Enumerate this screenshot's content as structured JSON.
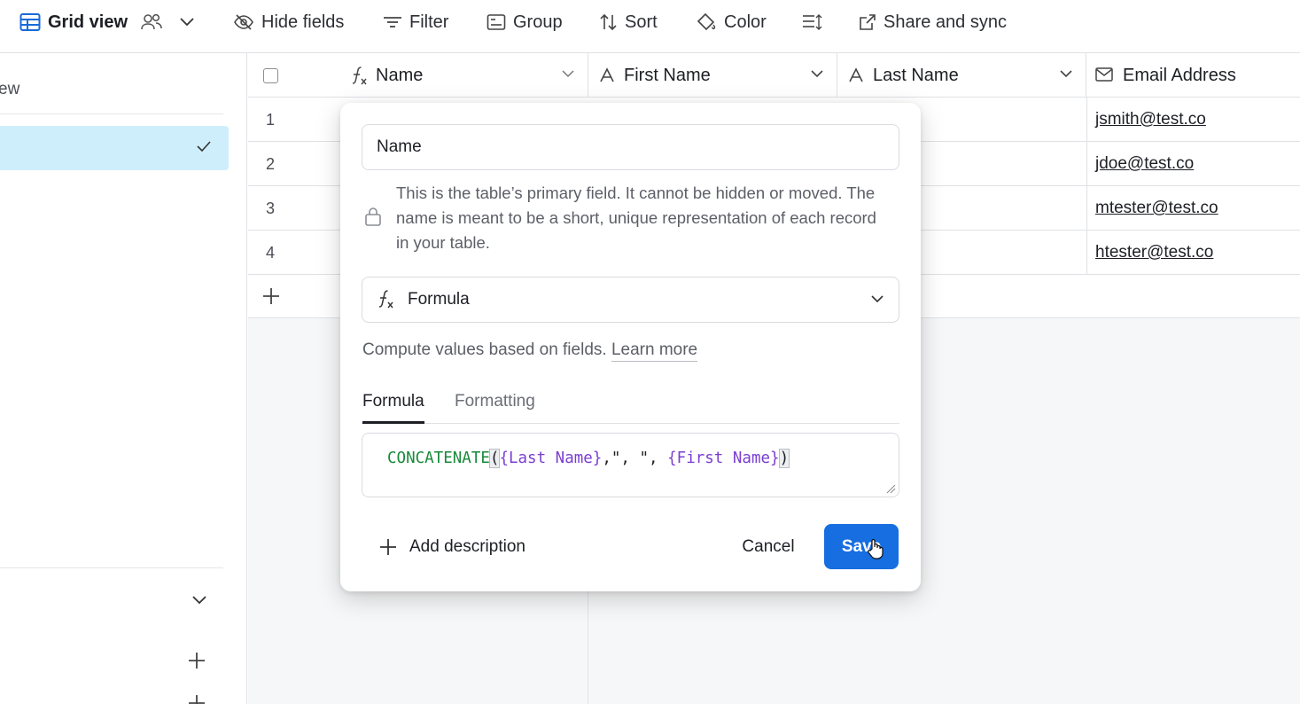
{
  "toolbar": {
    "view_name": "Grid view",
    "hide_fields": "Hide fields",
    "filter": "Filter",
    "group": "Group",
    "sort": "Sort",
    "color": "Color",
    "share_sync": "Share and sync"
  },
  "sidebar": {
    "partial_text": "ew"
  },
  "grid": {
    "columns": [
      {
        "label": "Name",
        "icon": "formula-icon"
      },
      {
        "label": "First Name",
        "icon": "text-icon"
      },
      {
        "label": "Last Name",
        "icon": "text-icon"
      },
      {
        "label": "Email Address",
        "icon": "email-icon"
      }
    ],
    "rows": [
      {
        "num": "1",
        "email": "jsmith@test.co"
      },
      {
        "num": "2",
        "email": "jdoe@test.co"
      },
      {
        "num": "3",
        "email": "mtester@test.co"
      },
      {
        "num": "4",
        "email": "htester@test.co"
      }
    ]
  },
  "field_editor": {
    "field_name": "Name",
    "primary_note": "This is the table’s primary field. It cannot be hidden or moved. The name is meant to be a short, unique representation of each record in your table.",
    "field_type": "Formula",
    "type_description": "Compute values based on fields.",
    "learn_more": "Learn more",
    "tabs": [
      "Formula",
      "Formatting"
    ],
    "formula": {
      "fn": "CONCATENATE",
      "open_paren": "(",
      "arg1": "{Last Name}",
      "sep": ",\", \", ",
      "arg2": "{First Name}",
      "close_paren": ")"
    },
    "add_description": "Add description",
    "cancel": "Cancel",
    "save": "Save"
  },
  "colors": {
    "accent": "#166ee1",
    "selected_bg": "#cfeefc",
    "formula_function": "#188a3a",
    "formula_field": "#7a3fd0"
  }
}
